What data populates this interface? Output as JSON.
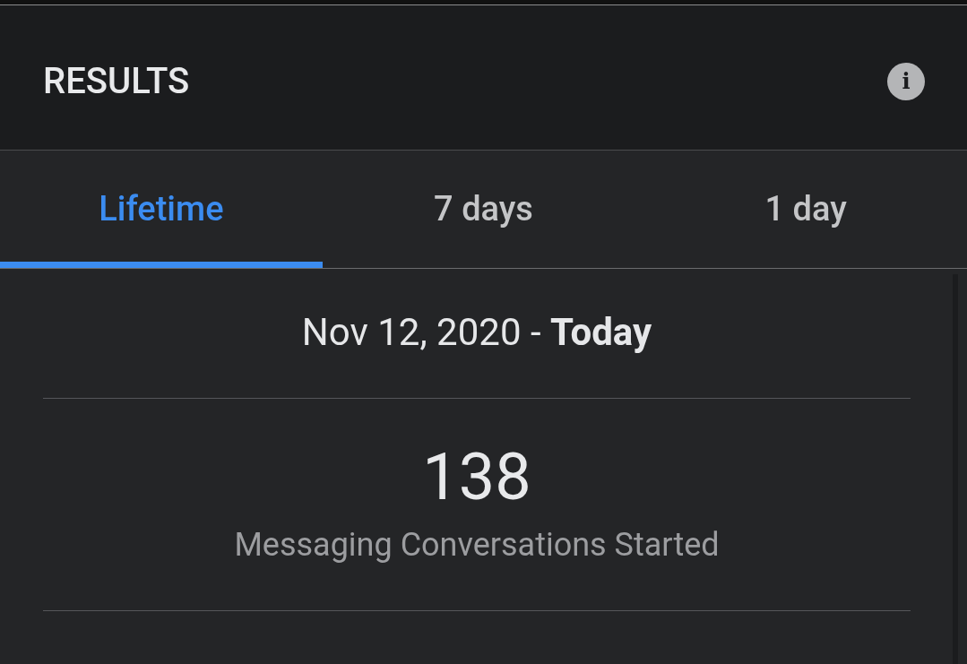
{
  "header": {
    "title": "RESULTS",
    "info_icon": "i"
  },
  "tabs": [
    {
      "label": "Lifetime",
      "selected": true
    },
    {
      "label": "7 days",
      "selected": false
    },
    {
      "label": "1 day",
      "selected": false
    }
  ],
  "date_range": "Nov 12, 2020 - **Today**",
  "metric": {
    "value": "138",
    "label": "Messaging Conversations Started"
  }
}
